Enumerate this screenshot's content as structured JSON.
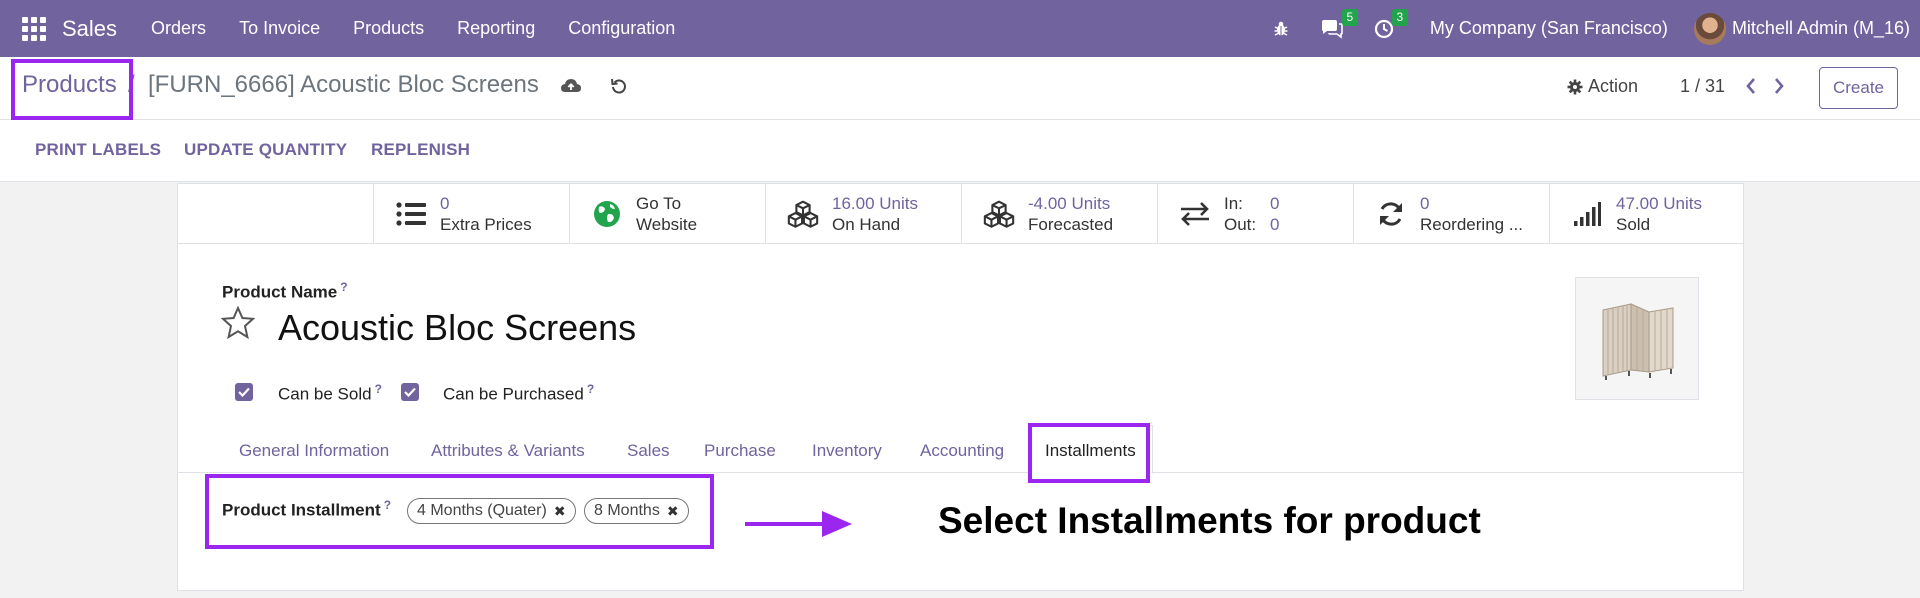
{
  "navbar": {
    "app_name": "Sales",
    "menu": [
      "Orders",
      "To Invoice",
      "Products",
      "Reporting",
      "Configuration"
    ],
    "messages_badge": "5",
    "activities_badge": "3",
    "company": "My Company (San Francisco)",
    "user": "Mitchell Admin (M_16)"
  },
  "breadcrumb": {
    "parent": "Products",
    "separator": "/",
    "current": "[FURN_6666] Acoustic Bloc Screens"
  },
  "controls": {
    "action_label": "Action",
    "pager": "1 / 31",
    "create_label": "Create"
  },
  "statusbar": {
    "buttons": [
      "PRINT LABELS",
      "UPDATE QUANTITY",
      "REPLENISH"
    ]
  },
  "stats": {
    "extra_prices": {
      "value": "0",
      "label": "Extra Prices"
    },
    "website": {
      "value": "Go To",
      "label": "Website"
    },
    "on_hand": {
      "value": "16.00 Units",
      "label": "On Hand"
    },
    "forecasted": {
      "value": "-4.00 Units",
      "label": "Forecasted"
    },
    "in_out": {
      "in_label": "In:",
      "in_value": "0",
      "out_label": "Out:",
      "out_value": "0"
    },
    "reordering": {
      "value": "0",
      "label": "Reordering ..."
    },
    "sold": {
      "value": "47.00 Units",
      "label": "Sold"
    }
  },
  "form": {
    "product_name_label": "Product Name",
    "help_mark": "?",
    "product_name": "Acoustic Bloc Screens",
    "can_be_sold_label": "Can be Sold",
    "can_be_sold": true,
    "can_be_purchased_label": "Can be Purchased",
    "can_be_purchased": true,
    "tabs": [
      "General Information",
      "Attributes & Variants",
      "Sales",
      "Purchase",
      "Inventory",
      "Accounting",
      "Installments"
    ],
    "active_tab": "Installments",
    "installment_label": "Product Installment",
    "installments": [
      "4 Months (Quater)",
      "8 Months"
    ]
  },
  "annotation": {
    "callout": "Select Installments for product",
    "color": "#9b26f0"
  },
  "colors": {
    "brand": "#71639e",
    "badge": "#21a44c"
  }
}
